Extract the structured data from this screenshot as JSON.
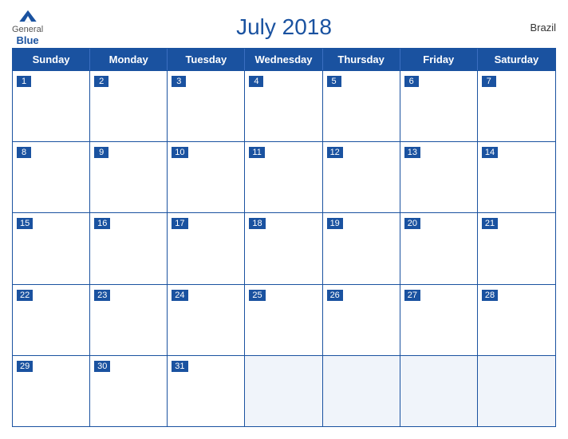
{
  "header": {
    "logo": {
      "general": "General",
      "blue": "Blue"
    },
    "title": "July 2018",
    "country": "Brazil"
  },
  "days_of_week": [
    "Sunday",
    "Monday",
    "Tuesday",
    "Wednesday",
    "Thursday",
    "Friday",
    "Saturday"
  ],
  "weeks": [
    [
      {
        "num": "1",
        "empty": false
      },
      {
        "num": "2",
        "empty": false
      },
      {
        "num": "3",
        "empty": false
      },
      {
        "num": "4",
        "empty": false
      },
      {
        "num": "5",
        "empty": false
      },
      {
        "num": "6",
        "empty": false
      },
      {
        "num": "7",
        "empty": false
      }
    ],
    [
      {
        "num": "8",
        "empty": false
      },
      {
        "num": "9",
        "empty": false
      },
      {
        "num": "10",
        "empty": false
      },
      {
        "num": "11",
        "empty": false
      },
      {
        "num": "12",
        "empty": false
      },
      {
        "num": "13",
        "empty": false
      },
      {
        "num": "14",
        "empty": false
      }
    ],
    [
      {
        "num": "15",
        "empty": false
      },
      {
        "num": "16",
        "empty": false
      },
      {
        "num": "17",
        "empty": false
      },
      {
        "num": "18",
        "empty": false
      },
      {
        "num": "19",
        "empty": false
      },
      {
        "num": "20",
        "empty": false
      },
      {
        "num": "21",
        "empty": false
      }
    ],
    [
      {
        "num": "22",
        "empty": false
      },
      {
        "num": "23",
        "empty": false
      },
      {
        "num": "24",
        "empty": false
      },
      {
        "num": "25",
        "empty": false
      },
      {
        "num": "26",
        "empty": false
      },
      {
        "num": "27",
        "empty": false
      },
      {
        "num": "28",
        "empty": false
      }
    ],
    [
      {
        "num": "29",
        "empty": false
      },
      {
        "num": "30",
        "empty": false
      },
      {
        "num": "31",
        "empty": false
      },
      {
        "num": "",
        "empty": true
      },
      {
        "num": "",
        "empty": true
      },
      {
        "num": "",
        "empty": true
      },
      {
        "num": "",
        "empty": true
      }
    ]
  ]
}
